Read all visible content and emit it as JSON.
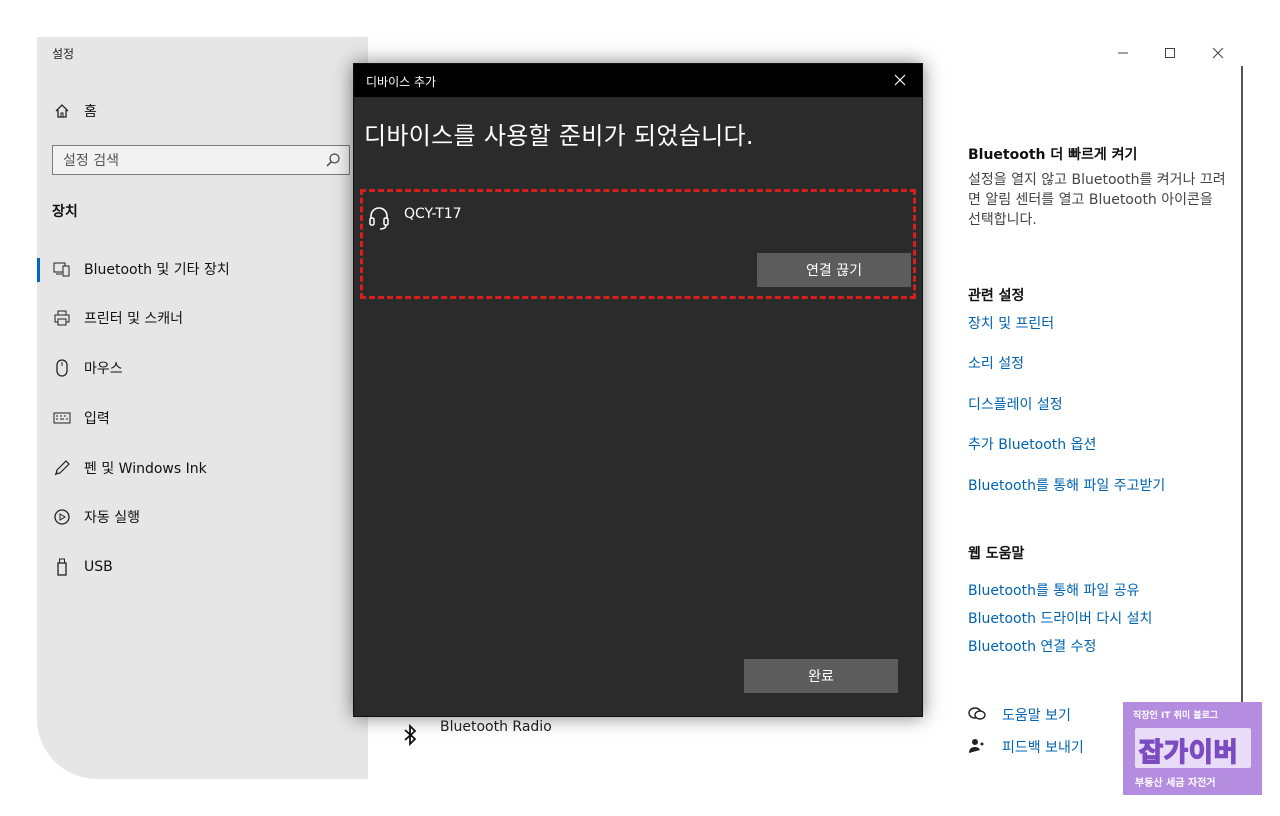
{
  "window": {
    "title": "설정"
  },
  "sidebar": {
    "home_label": "홈",
    "search_placeholder": "설정 검색",
    "section_label": "장치",
    "items": [
      {
        "label": "Bluetooth 및 기타 장치",
        "icon": "bluetooth-devices-icon",
        "selected": true
      },
      {
        "label": "프린터 및 스캐너",
        "icon": "printer-icon"
      },
      {
        "label": "마우스",
        "icon": "mouse-icon"
      },
      {
        "label": "입력",
        "icon": "keyboard-icon"
      },
      {
        "label": "펜 및 Windows Ink",
        "icon": "pen-icon"
      },
      {
        "label": "자동 실행",
        "icon": "autoplay-icon"
      },
      {
        "label": "USB",
        "icon": "usb-icon"
      }
    ]
  },
  "dialog": {
    "title": "디바이스 추가",
    "heading": "디바이스를 사용할 준비가 되었습니다.",
    "device": {
      "name": "QCY-T17",
      "icon": "headset-icon"
    },
    "disconnect_label": "연결 끊기",
    "done_label": "완료"
  },
  "main": {
    "bluetooth_radio_label": "Bluetooth Radio"
  },
  "right_panel": {
    "tip_heading": "Bluetooth 더 빠르게 켜기",
    "tip_text": "설정을 열지 않고 Bluetooth를 켜거나 끄려면 알림 센터를 열고 Bluetooth 아이콘을 선택합니다.",
    "related_heading": "관련 설정",
    "related_links": [
      "장치 및 프린터",
      "소리 설정",
      "디스플레이 설정",
      "추가 Bluetooth 옵션",
      "Bluetooth를 통해 파일 주고받기"
    ],
    "web_help_heading": "웹 도움말",
    "web_help_links": [
      "Bluetooth를 통해 파일 공유",
      "Bluetooth 드라이버 다시 설치",
      "Bluetooth 연결 수정"
    ],
    "get_help_label": "도움말 보기",
    "feedback_label": "피드백 보내기"
  },
  "watermark": {
    "top_text": "직장인 IT 취미 블로그",
    "main_text": "잡가이버",
    "bottom_text": "부동산 세금 자전거"
  },
  "colors": {
    "accent": "#0067c0",
    "link": "#0063b1",
    "dialog_bg": "#2b2b2b",
    "highlight": "#d62020",
    "watermark": "#b58de0"
  }
}
